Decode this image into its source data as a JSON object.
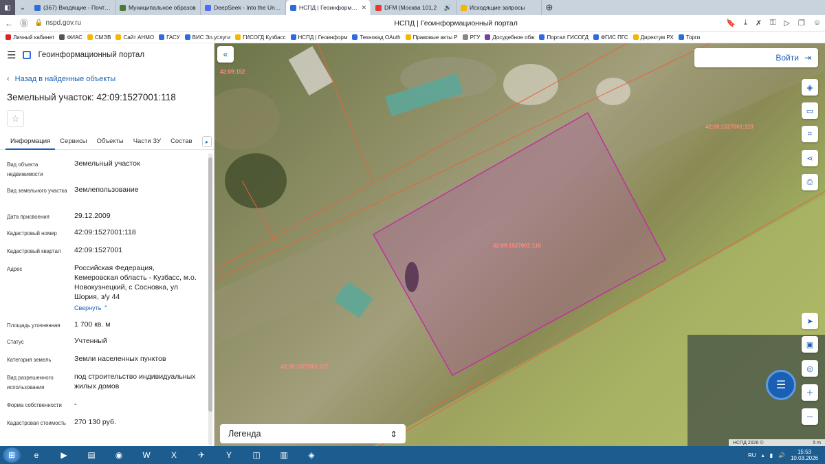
{
  "browser": {
    "tabs": [
      {
        "label": "(367) Входящие - Почта М",
        "color": "#2f6fd6",
        "active": false
      },
      {
        "label": "Муниципальное образов",
        "color": "#4a7a3a",
        "active": false
      },
      {
        "label": "DeepSeek - Into the Unkno",
        "color": "#4d6bfe",
        "active": false
      },
      {
        "label": "НСПД | Геоинформацио",
        "color": "#2d6cdf",
        "active": true
      },
      {
        "label": "DFM (Москва 101,2",
        "color": "#e53935",
        "active": false
      },
      {
        "label": "Исходящие запросы",
        "color": "#f6b600",
        "active": false
      }
    ],
    "url": "nspd.gov.ru",
    "page_title": "НСПД | Геоинформационный портал",
    "bookmarks": [
      "Личный кабинет",
      "ФИАС",
      "СМЭВ",
      "Сайт АНМО",
      "ГАСУ",
      "ВИС Эл.услуги",
      "ГИСОГД Кузбасс",
      "НСПД | Геоинформ",
      "Технокад OAuth",
      "Правовые акты Р",
      "РГУ",
      "Досудебное обж",
      "Портал ГИСОГД",
      "ФГИС ПГС",
      "Директум РХ",
      "Торги"
    ]
  },
  "sidebar": {
    "portal_name": "Геоинформационный портал",
    "back_label": "Назад в найденные объекты",
    "object_title": "Земельный участок: 42:09:1527001:118",
    "tabs": [
      "Информация",
      "Сервисы",
      "Объекты",
      "Части ЗУ",
      "Состав"
    ],
    "collapse_label": "Свернуть",
    "properties": [
      {
        "label": "Вид объекта недвижимости",
        "value": "Земельный участок"
      },
      {
        "label": "Вид земельного участка",
        "value": "Землепользование"
      },
      {
        "label": "Дата присвоения",
        "value": "29.12.2009"
      },
      {
        "label": "Кадастровый номер",
        "value": "42:09:1527001:118"
      },
      {
        "label": "Кадастровый квартал",
        "value": "42:09:1527001"
      },
      {
        "label": "Адрес",
        "value": "Российская Федерация, Кемеровская область - Кузбасс, м.о. Новокузнецкий, с Сосновка, ул Шория, з/у 44"
      },
      {
        "label": "Площадь уточненная",
        "value": "1 700 кв. м"
      },
      {
        "label": "Статус",
        "value": "Учтенный"
      },
      {
        "label": "Категория земель",
        "value": "Земли населенных пунктов"
      },
      {
        "label": "Вид разрешенного использования",
        "value": "под строительство индивидуальных жилых домов"
      },
      {
        "label": "Форма собственности",
        "value": "-"
      },
      {
        "label": "Кадастровая стоимость",
        "value": "270 130 руб."
      }
    ]
  },
  "map": {
    "login_label": "Войти",
    "legend_label": "Легенда",
    "parcel_labels": [
      "42:09:152",
      "42:09:1527001:119",
      "42:09:1527001:118",
      "42:09:1527001:117"
    ],
    "attribution": "НСПД 2026 ©",
    "scale": "5 m",
    "tools": [
      "layers-icon",
      "ruler-icon",
      "select-icon",
      "share-icon",
      "print-icon",
      "locate-icon",
      "minimap-icon",
      "search-location-icon",
      "zoom-in-icon",
      "zoom-out-icon"
    ]
  },
  "taskbar": {
    "lang": "RU",
    "time": "15:53",
    "date": "10.03.2026"
  }
}
